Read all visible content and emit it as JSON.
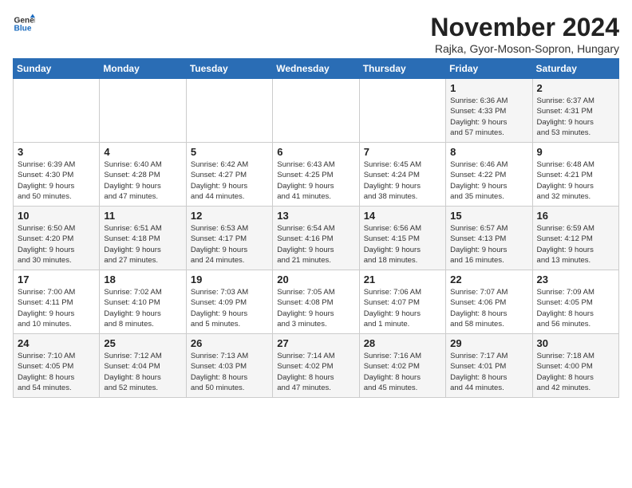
{
  "logo": {
    "line1": "General",
    "line2": "Blue"
  },
  "title": "November 2024",
  "subtitle": "Rajka, Gyor-Moson-Sopron, Hungary",
  "days_header": [
    "Sunday",
    "Monday",
    "Tuesday",
    "Wednesday",
    "Thursday",
    "Friday",
    "Saturday"
  ],
  "weeks": [
    [
      {
        "day": "",
        "info": ""
      },
      {
        "day": "",
        "info": ""
      },
      {
        "day": "",
        "info": ""
      },
      {
        "day": "",
        "info": ""
      },
      {
        "day": "",
        "info": ""
      },
      {
        "day": "1",
        "info": "Sunrise: 6:36 AM\nSunset: 4:33 PM\nDaylight: 9 hours\nand 57 minutes."
      },
      {
        "day": "2",
        "info": "Sunrise: 6:37 AM\nSunset: 4:31 PM\nDaylight: 9 hours\nand 53 minutes."
      }
    ],
    [
      {
        "day": "3",
        "info": "Sunrise: 6:39 AM\nSunset: 4:30 PM\nDaylight: 9 hours\nand 50 minutes."
      },
      {
        "day": "4",
        "info": "Sunrise: 6:40 AM\nSunset: 4:28 PM\nDaylight: 9 hours\nand 47 minutes."
      },
      {
        "day": "5",
        "info": "Sunrise: 6:42 AM\nSunset: 4:27 PM\nDaylight: 9 hours\nand 44 minutes."
      },
      {
        "day": "6",
        "info": "Sunrise: 6:43 AM\nSunset: 4:25 PM\nDaylight: 9 hours\nand 41 minutes."
      },
      {
        "day": "7",
        "info": "Sunrise: 6:45 AM\nSunset: 4:24 PM\nDaylight: 9 hours\nand 38 minutes."
      },
      {
        "day": "8",
        "info": "Sunrise: 6:46 AM\nSunset: 4:22 PM\nDaylight: 9 hours\nand 35 minutes."
      },
      {
        "day": "9",
        "info": "Sunrise: 6:48 AM\nSunset: 4:21 PM\nDaylight: 9 hours\nand 32 minutes."
      }
    ],
    [
      {
        "day": "10",
        "info": "Sunrise: 6:50 AM\nSunset: 4:20 PM\nDaylight: 9 hours\nand 30 minutes."
      },
      {
        "day": "11",
        "info": "Sunrise: 6:51 AM\nSunset: 4:18 PM\nDaylight: 9 hours\nand 27 minutes."
      },
      {
        "day": "12",
        "info": "Sunrise: 6:53 AM\nSunset: 4:17 PM\nDaylight: 9 hours\nand 24 minutes."
      },
      {
        "day": "13",
        "info": "Sunrise: 6:54 AM\nSunset: 4:16 PM\nDaylight: 9 hours\nand 21 minutes."
      },
      {
        "day": "14",
        "info": "Sunrise: 6:56 AM\nSunset: 4:15 PM\nDaylight: 9 hours\nand 18 minutes."
      },
      {
        "day": "15",
        "info": "Sunrise: 6:57 AM\nSunset: 4:13 PM\nDaylight: 9 hours\nand 16 minutes."
      },
      {
        "day": "16",
        "info": "Sunrise: 6:59 AM\nSunset: 4:12 PM\nDaylight: 9 hours\nand 13 minutes."
      }
    ],
    [
      {
        "day": "17",
        "info": "Sunrise: 7:00 AM\nSunset: 4:11 PM\nDaylight: 9 hours\nand 10 minutes."
      },
      {
        "day": "18",
        "info": "Sunrise: 7:02 AM\nSunset: 4:10 PM\nDaylight: 9 hours\nand 8 minutes."
      },
      {
        "day": "19",
        "info": "Sunrise: 7:03 AM\nSunset: 4:09 PM\nDaylight: 9 hours\nand 5 minutes."
      },
      {
        "day": "20",
        "info": "Sunrise: 7:05 AM\nSunset: 4:08 PM\nDaylight: 9 hours\nand 3 minutes."
      },
      {
        "day": "21",
        "info": "Sunrise: 7:06 AM\nSunset: 4:07 PM\nDaylight: 9 hours\nand 1 minute."
      },
      {
        "day": "22",
        "info": "Sunrise: 7:07 AM\nSunset: 4:06 PM\nDaylight: 8 hours\nand 58 minutes."
      },
      {
        "day": "23",
        "info": "Sunrise: 7:09 AM\nSunset: 4:05 PM\nDaylight: 8 hours\nand 56 minutes."
      }
    ],
    [
      {
        "day": "24",
        "info": "Sunrise: 7:10 AM\nSunset: 4:05 PM\nDaylight: 8 hours\nand 54 minutes."
      },
      {
        "day": "25",
        "info": "Sunrise: 7:12 AM\nSunset: 4:04 PM\nDaylight: 8 hours\nand 52 minutes."
      },
      {
        "day": "26",
        "info": "Sunrise: 7:13 AM\nSunset: 4:03 PM\nDaylight: 8 hours\nand 50 minutes."
      },
      {
        "day": "27",
        "info": "Sunrise: 7:14 AM\nSunset: 4:02 PM\nDaylight: 8 hours\nand 47 minutes."
      },
      {
        "day": "28",
        "info": "Sunrise: 7:16 AM\nSunset: 4:02 PM\nDaylight: 8 hours\nand 45 minutes."
      },
      {
        "day": "29",
        "info": "Sunrise: 7:17 AM\nSunset: 4:01 PM\nDaylight: 8 hours\nand 44 minutes."
      },
      {
        "day": "30",
        "info": "Sunrise: 7:18 AM\nSunset: 4:00 PM\nDaylight: 8 hours\nand 42 minutes."
      }
    ]
  ]
}
